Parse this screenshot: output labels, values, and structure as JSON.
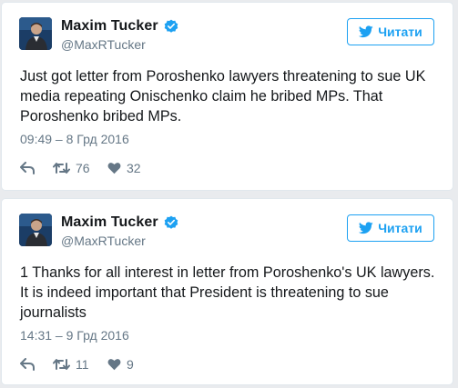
{
  "colors": {
    "accent": "#1da1f2",
    "text": "#14171a",
    "muted": "#657786",
    "background": "#e9ebee",
    "card": "#ffffff"
  },
  "tweets": [
    {
      "author": {
        "name": "Maxim Tucker",
        "handle": "@MaxRTucker",
        "verified": true
      },
      "follow_label": "Читати",
      "text": "Just got letter from Poroshenko lawyers threatening to sue UK media repeating Onischenko claim he bribed MPs. That Poroshenko bribed MPs.",
      "timestamp": "09:49 – 8 Грд 2016",
      "retweets": "76",
      "likes": "32"
    },
    {
      "author": {
        "name": "Maxim Tucker",
        "handle": "@MaxRTucker",
        "verified": true
      },
      "follow_label": "Читати",
      "text": "1 Thanks for all interest in letter from Poroshenko's UK lawyers. It is indeed important that President is threatening to sue journalists",
      "timestamp": "14:31 – 9 Грд 2016",
      "retweets": "11",
      "likes": "9"
    }
  ]
}
